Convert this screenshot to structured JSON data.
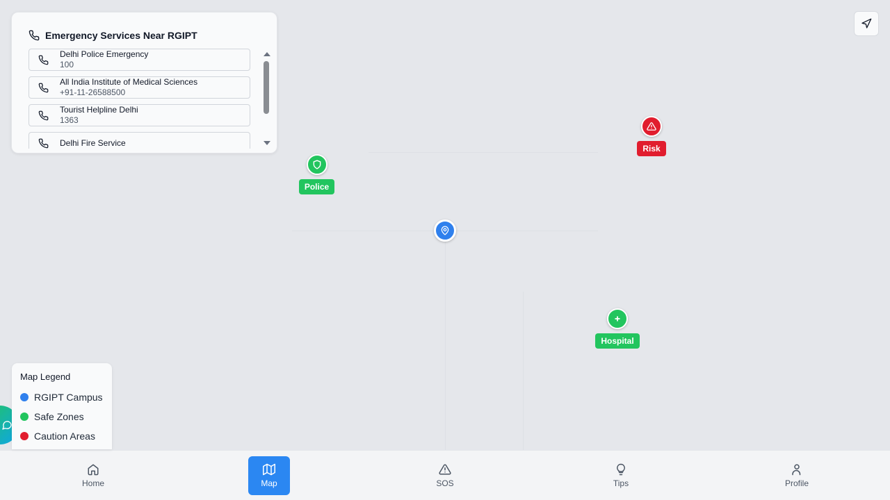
{
  "emergency_panel": {
    "title": "Emergency Services Near RGIPT",
    "services": [
      {
        "name": "Delhi Police Emergency",
        "number": "100"
      },
      {
        "name": "All India Institute of Medical Sciences",
        "number": "+91-11-26588500"
      },
      {
        "name": "Tourist Helpline Delhi",
        "number": "1363"
      },
      {
        "name": "Delhi Fire Service",
        "number": ""
      }
    ]
  },
  "map_markers": {
    "police": {
      "label": "Police",
      "icon": "shield-icon"
    },
    "risk": {
      "label": "Risk",
      "icon": "warning-icon"
    },
    "hospital": {
      "label": "Hospital",
      "icon": "plus-icon"
    },
    "campus": {
      "icon": "map-pin-icon"
    }
  },
  "legend": {
    "title": "Map Legend",
    "items": [
      {
        "label": "RGIPT Campus",
        "color": "#2f80ed"
      },
      {
        "label": "Safe Zones",
        "color": "#22c55e"
      },
      {
        "label": "Caution Areas",
        "color": "#e11d2e"
      }
    ]
  },
  "bottom_nav": {
    "items": [
      {
        "label": "Home",
        "icon": "home-icon",
        "active": false
      },
      {
        "label": "Map",
        "icon": "map-icon",
        "active": true
      },
      {
        "label": "SOS",
        "icon": "warning-icon",
        "active": false
      },
      {
        "label": "Tips",
        "icon": "lightbulb-icon",
        "active": false
      },
      {
        "label": "Profile",
        "icon": "user-icon",
        "active": false
      }
    ]
  },
  "colors": {
    "safe": "#22c55e",
    "caution": "#e11d2e",
    "campus": "#2f80ed",
    "nav_active": "#2b87f2"
  }
}
